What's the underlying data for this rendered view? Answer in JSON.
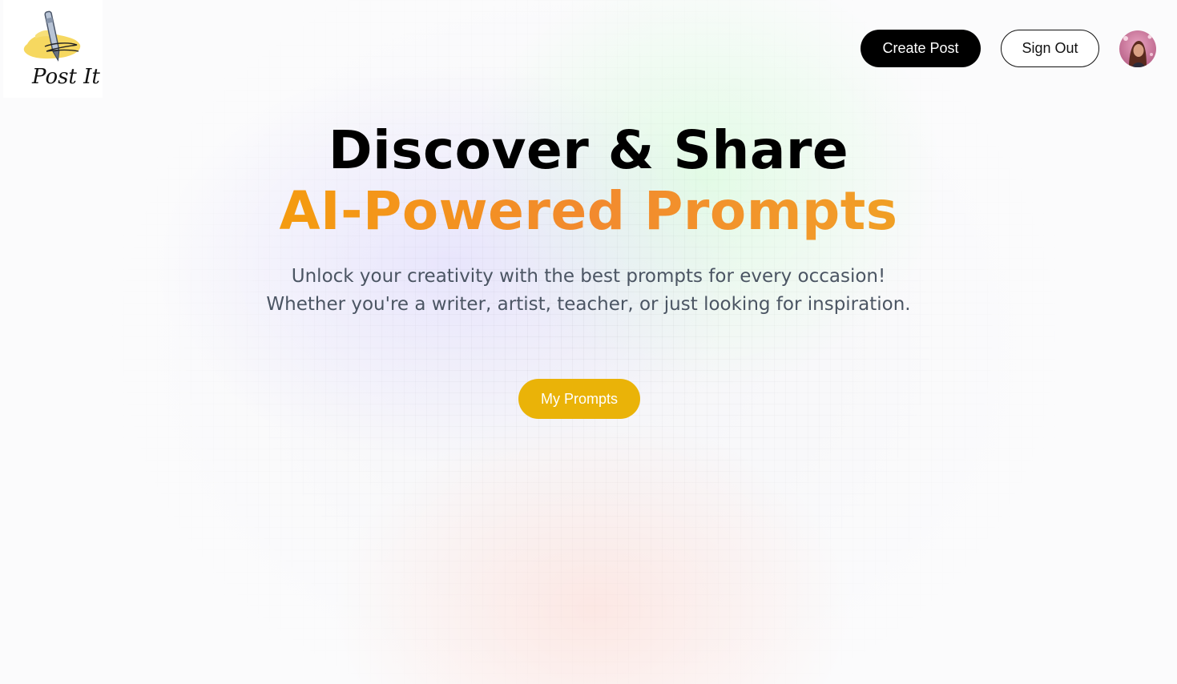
{
  "header": {
    "logo_text": "Post It",
    "create_post_label": "Create Post",
    "sign_out_label": "Sign Out"
  },
  "hero": {
    "title_line1": "Discover & Share",
    "title_line2": "AI-Powered Prompts",
    "subtitle": "Unlock your creativity with the best prompts for every occasion! Whether you're a writer, artist, teacher, or just looking for inspiration.",
    "cta_label": "My Prompts"
  },
  "colors": {
    "accent": "#eab308",
    "gradient_orange": "#f28a2e",
    "dark_button": "#000000",
    "subtitle_text": "#4b5563"
  },
  "icons": {
    "logo": "pen-scribble-logo-icon",
    "avatar": "user-avatar-icon"
  }
}
